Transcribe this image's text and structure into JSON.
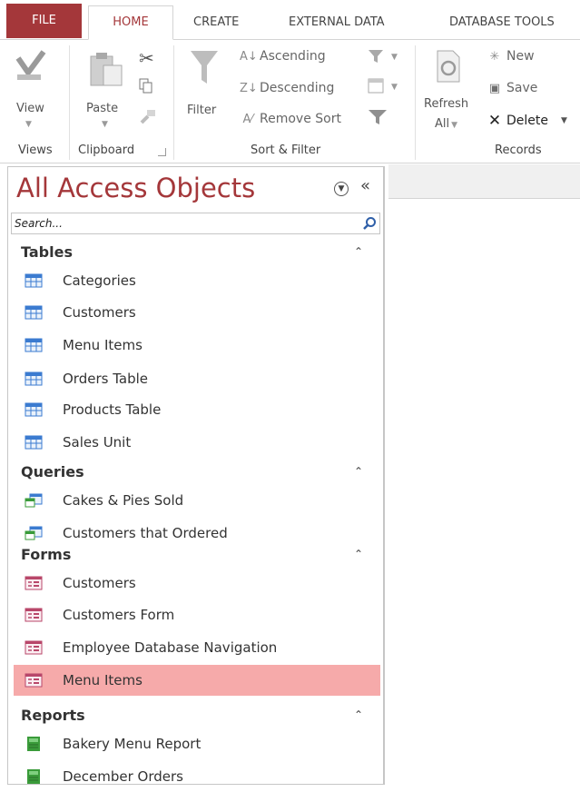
{
  "ribbon_tabs": {
    "file": "FILE",
    "home": "HOME",
    "create": "CREATE",
    "external_data": "EXTERNAL DATA",
    "database_tools": "DATABASE TOOLS"
  },
  "ribbon": {
    "views": {
      "view_label": "View",
      "group_label": "Views"
    },
    "clipboard": {
      "paste_label": "Paste",
      "group_label": "Clipboard"
    },
    "sort_filter": {
      "filter_label": "Filter",
      "ascending": "Ascending",
      "descending": "Descending",
      "remove_sort": "Remove Sort",
      "group_label": "Sort & Filter"
    },
    "records": {
      "refresh_line1": "Refresh",
      "refresh_line2": "All",
      "new": "New",
      "save": "Save",
      "delete": "Delete",
      "group_label": "Records"
    }
  },
  "nav": {
    "title": "All Access Objects",
    "search_placeholder": "Search...",
    "sections": {
      "tables": {
        "label": "Tables",
        "items": [
          "Categories",
          "Customers",
          "Menu Items",
          "Orders Table",
          "Products Table",
          "Sales Unit"
        ]
      },
      "queries": {
        "label": "Queries",
        "items": [
          "Cakes & Pies Sold",
          "Customers that Ordered"
        ]
      },
      "forms": {
        "label": "Forms",
        "items": [
          "Customers",
          "Customers Form",
          "Employee Database Navigation",
          "Menu Items"
        ]
      },
      "reports": {
        "label": "Reports",
        "items": [
          "Bakery Menu Report",
          "December Orders"
        ]
      }
    }
  },
  "colors": {
    "accent": "#a4373a",
    "selected_row": "#f6aaaa",
    "table_icon": "#3b7bd0",
    "report_icon": "#3a9b3a"
  }
}
